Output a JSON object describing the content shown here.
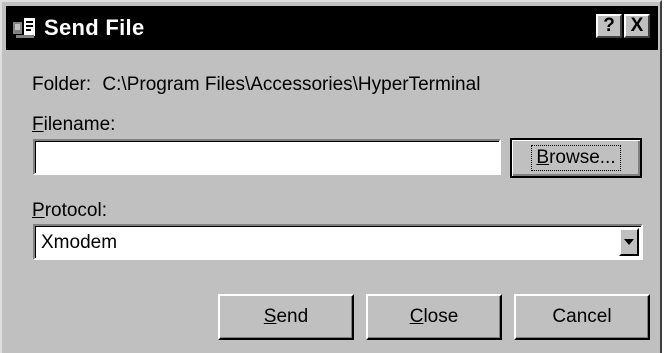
{
  "window": {
    "title": "Send File",
    "help_glyph": "?",
    "close_glyph": "X",
    "icon": "terminal-app-icon"
  },
  "folder": {
    "label": "Folder:",
    "path": "C:\\Program Files\\Accessories\\HyperTerminal"
  },
  "filename": {
    "label_mnemonic": "F",
    "label_rest": "ilename:",
    "value": "",
    "browse_mnemonic": "B",
    "browse_rest": "rowse..."
  },
  "protocol": {
    "label_mnemonic": "P",
    "label_rest": "rotocol:",
    "selected": "Xmodem"
  },
  "buttons": {
    "send_mnemonic": "S",
    "send_rest": "end",
    "close_mnemonic": "C",
    "close_rest": "lose",
    "cancel": "Cancel"
  },
  "colors": {
    "face": "#c0c0c0",
    "titlebar": "#000000",
    "field": "#ffffff"
  }
}
